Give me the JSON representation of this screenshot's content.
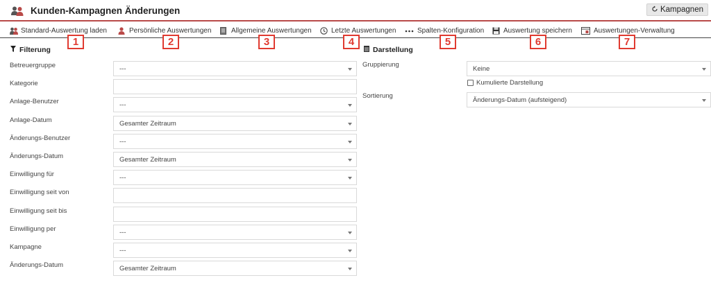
{
  "header": {
    "title": "Kunden-Kampagnen Änderungen",
    "back_button": "Kampagnen",
    "logo_icon": "users-icon"
  },
  "toolbar": {
    "items": [
      {
        "label": "Standard-Auswertung laden",
        "icon": "users-icon"
      },
      {
        "label": "Persönliche Auswertungen",
        "icon": "user-icon"
      },
      {
        "label": "Allgemeine Auswertungen",
        "icon": "document-icon"
      },
      {
        "label": "Letzte Auswertungen",
        "icon": "clock-icon"
      },
      {
        "label": "Spalten-Konfiguration",
        "icon": "dots-icon"
      },
      {
        "label": "Auswertung speichern",
        "icon": "save-icon"
      },
      {
        "label": "Auswertungen-Verwaltung",
        "icon": "window-settings-icon"
      }
    ],
    "badges": [
      "1",
      "2",
      "3",
      "4",
      "5",
      "6",
      "7"
    ]
  },
  "filter": {
    "title": "Filterung",
    "rows": [
      {
        "label": "Betreuergruppe",
        "value": "---",
        "type": "select"
      },
      {
        "label": "Kategorie",
        "value": "",
        "type": "text"
      },
      {
        "label": "Anlage-Benutzer",
        "value": "---",
        "type": "select"
      },
      {
        "label": "Anlage-Datum",
        "value": "Gesamter Zeitraum",
        "type": "select"
      },
      {
        "label": "Änderungs-Benutzer",
        "value": "---",
        "type": "select"
      },
      {
        "label": "Änderungs-Datum",
        "value": "Gesamter Zeitraum",
        "type": "select"
      },
      {
        "label": "Einwilligung für",
        "value": "---",
        "type": "select"
      },
      {
        "label": "Einwilligung seit von",
        "value": "",
        "type": "text"
      },
      {
        "label": "Einwilligung seit bis",
        "value": "",
        "type": "text"
      },
      {
        "label": "Einwilligung per",
        "value": "---",
        "type": "select"
      },
      {
        "label": "Kampagne",
        "value": "---",
        "type": "select"
      },
      {
        "label": "Änderungs-Datum",
        "value": "Gesamter Zeitraum",
        "type": "select"
      }
    ]
  },
  "display": {
    "title": "Darstellung",
    "grouping_label": "Gruppierung",
    "grouping_value": "Keine",
    "cumulative_label": "Kumulierte Darstellung",
    "sorting_label": "Sortierung",
    "sorting_value": "Änderungs-Datum (aufsteigend)"
  },
  "colors": {
    "accent": "#b94a48",
    "badge": "#e03a30"
  }
}
